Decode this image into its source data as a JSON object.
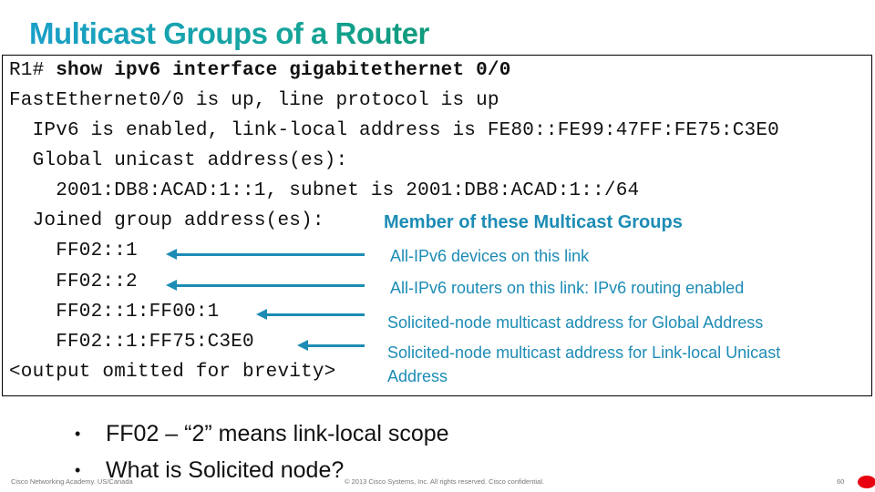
{
  "slide": {
    "title": "Multicast Groups of a Router",
    "terminal": {
      "prompt": "R1# ",
      "command": "show ipv6 interface gigabitethernet 0/0",
      "lines": [
        "FastEthernet0/0 is up, line protocol is up",
        "  IPv6 is enabled, link-local address is FE80::FE99:47FF:FE75:C3E0",
        "  Global unicast address(es):",
        "    2001:DB8:ACAD:1::1, subnet is 2001:DB8:ACAD:1::/64",
        "  Joined group address(es):",
        "    FF02::1",
        "    FF02::2",
        "    FF02::1:FF00:1",
        "    FF02::1:FF75:C3E0",
        "<output omitted for brevity>"
      ]
    },
    "annotations": {
      "heading": "Member of these Multicast Groups",
      "items": [
        "All-IPv6 devices on this link",
        "All-IPv6 routers on this link: IPv6 routing enabled",
        "Solicited-node multicast address for Global Address",
        "Solicited-node multicast address for Link-local Unicast",
        "Address"
      ]
    },
    "bullets": [
      "FF02 – “2” means link-local scope",
      "What is Solicited node?"
    ],
    "footer": {
      "left": "Cisco Networking Academy. US/Canada",
      "center": "© 2013 Cisco Systems, Inc. All rights reserved. Cisco confidential.",
      "page": "60"
    },
    "colors": {
      "accent": "#1d8cb5",
      "title_gradient_start": "#1a9fc9",
      "title_gradient_end": "#0f9a7a",
      "cisco_red": "#e8000f"
    }
  }
}
